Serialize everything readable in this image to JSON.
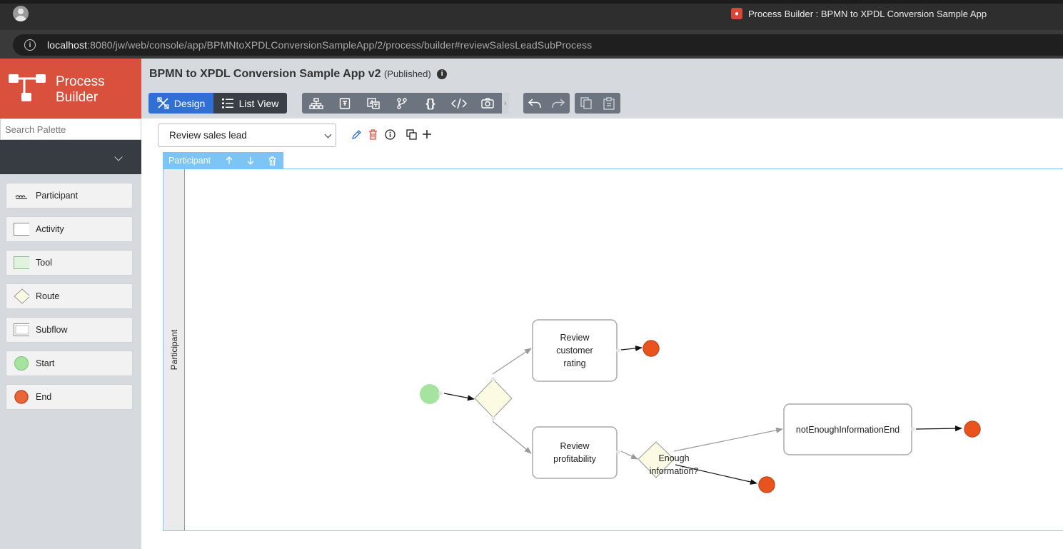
{
  "browser": {
    "tab_title": "Process Builder : BPMN to XPDL Conversion Sample App",
    "url_host": "localhost",
    "url_rest": ":8080/jw/web/console/app/BPMNtoXPDLConversionSampleApp/2/process/builder#reviewSalesLeadSubProcess"
  },
  "brand": {
    "line1": "Process",
    "line2": "Builder"
  },
  "sidebar": {
    "search_placeholder": "Search Palette",
    "items": [
      {
        "label": "Participant",
        "icon": "swimlane-icon"
      },
      {
        "label": "Activity",
        "icon": "activity-icon"
      },
      {
        "label": "Tool",
        "icon": "tool-icon"
      },
      {
        "label": "Route",
        "icon": "route-icon"
      },
      {
        "label": "Subflow",
        "icon": "subflow-icon"
      },
      {
        "label": "Start",
        "icon": "start-icon"
      },
      {
        "label": "End",
        "icon": "end-icon"
      }
    ]
  },
  "header": {
    "title": "BPMN to XPDL Conversion Sample App v2",
    "status": "(Published)"
  },
  "toolbar": {
    "design_label": "Design",
    "list_view_label": "List View",
    "tools": [
      "participants-icon",
      "variables-icon",
      "mapping-icon",
      "branch-icon",
      "json-icon",
      "code-icon",
      "camera-icon"
    ],
    "history": [
      "undo-icon",
      "redo-icon"
    ],
    "clipboard": [
      "copy-icon",
      "paste-icon"
    ]
  },
  "process_select": {
    "value": "Review sales lead"
  },
  "pool": {
    "header_label": "Participant",
    "lane_label": "Participant"
  },
  "diagram": {
    "activities": [
      {
        "id": "review-customer-rating",
        "label": "Review customer rating"
      },
      {
        "id": "review-profitability",
        "label": "Review profitability"
      },
      {
        "id": "not-enough-information-end",
        "label": "notEnoughInformationEnd"
      }
    ],
    "route_label": "Enough information?"
  },
  "colors": {
    "brand": "#d9503c",
    "design_active": "#2f6fd6",
    "start": "#a6e3a1",
    "end": "#e8531e",
    "route": "#fbfbe3",
    "pool_border": "#7cc4f4"
  }
}
